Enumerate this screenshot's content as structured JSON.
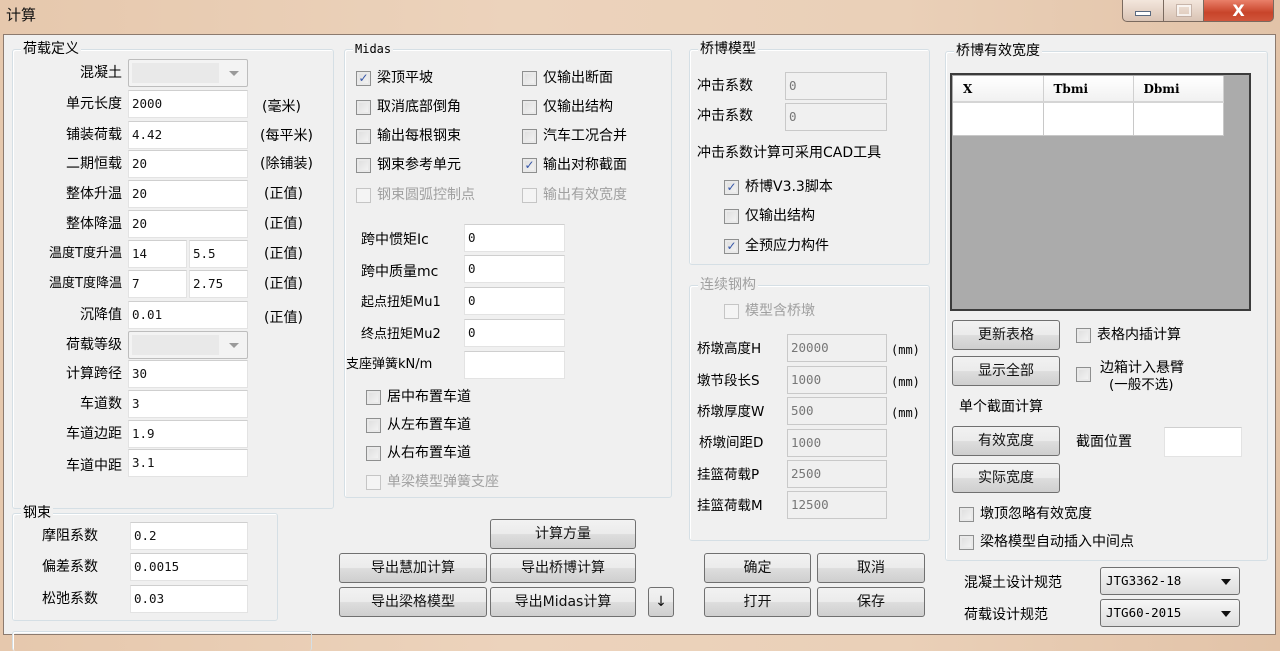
{
  "window": {
    "title": "计算",
    "controls": {
      "minimize": "minimize",
      "maximize": "maximize",
      "close": "X"
    }
  },
  "load_definition": {
    "title": "荷载定义",
    "concrete_label": "混凝土",
    "concrete_value": "",
    "element_length_label": "单元长度",
    "element_length_value": "2000",
    "element_length_unit": "(毫米)",
    "paving_load_label": "铺装荷载",
    "paving_load_value": "4.42",
    "paving_load_unit": "(每平米)",
    "second_dead_label": "二期恒载",
    "second_dead_value": "20",
    "second_dead_unit": "(除铺装)",
    "temp_rise_label": "整体升温",
    "temp_rise_value": "20",
    "temp_rise_unit": "(正值)",
    "temp_drop_label": "整体降温",
    "temp_drop_value": "20",
    "temp_drop_unit": "(正值)",
    "grad_rise_label": "温度T度升温",
    "grad_rise_value1": "14",
    "grad_rise_value2": "5.5",
    "grad_rise_unit": "(正值)",
    "grad_drop_label": "温度T度降温",
    "grad_drop_value1": "7",
    "grad_drop_value2": "2.75",
    "grad_drop_unit": "(正值)",
    "settlement_label": "沉降值",
    "settlement_value": "0.01",
    "settlement_unit": "(正值)",
    "load_grade_label": "荷载等级",
    "load_grade_value": "",
    "span_label": "计算跨径",
    "span_value": "30",
    "lanes_label": "车道数",
    "lanes_value": "3",
    "lane_edge_label": "车道边距",
    "lane_edge_value": "1.9",
    "lane_center_label": "车道中距",
    "lane_center_value": "3.1"
  },
  "tendon": {
    "title": "钢束",
    "friction_label": "摩阻系数",
    "friction_value": "0.2",
    "deviation_label": "偏差系数",
    "deviation_value": "0.0015",
    "relaxation_label": "松弛系数",
    "relaxation_value": "0.03"
  },
  "midas": {
    "title": "Midas",
    "checkboxes": [
      {
        "label": "梁顶平坡",
        "checked": true,
        "enabled": true
      },
      {
        "label": "仅输出断面",
        "checked": false,
        "enabled": true
      },
      {
        "label": "取消底部倒角",
        "checked": false,
        "enabled": true
      },
      {
        "label": "仅输出结构",
        "checked": false,
        "enabled": true
      },
      {
        "label": "输出每根钢束",
        "checked": false,
        "enabled": true
      },
      {
        "label": "汽车工况合并",
        "checked": false,
        "enabled": true
      },
      {
        "label": "钢束参考单元",
        "checked": false,
        "enabled": true
      },
      {
        "label": "输出对称截面",
        "checked": true,
        "enabled": true
      },
      {
        "label": "钢束圆弧控制点",
        "checked": false,
        "enabled": false
      },
      {
        "label": "输出有效宽度",
        "checked": false,
        "enabled": false
      }
    ],
    "inertia_label": "跨中惯矩Ic",
    "inertia_value": "0",
    "mass_label": "跨中质量mc",
    "mass_value": "0",
    "torsion_start_label": "起点扭矩Mu1",
    "torsion_start_value": "0",
    "torsion_end_label": "终点扭矩Mu2",
    "torsion_end_value": "0",
    "spring_label": "支座弹簧kN/m",
    "spring_value": "",
    "lane_checkboxes": [
      {
        "label": "居中布置车道",
        "checked": false,
        "enabled": true
      },
      {
        "label": "从左布置车道",
        "checked": false,
        "enabled": true
      },
      {
        "label": "从右布置车道",
        "checked": false,
        "enabled": true
      },
      {
        "label": "单梁模型弹簧支座",
        "checked": false,
        "enabled": false
      }
    ]
  },
  "qiaobo": {
    "title": "桥博模型",
    "impact1_label": "冲击系数",
    "impact1_value": "0",
    "impact2_label": "冲击系数",
    "impact2_value": "0",
    "impact_note": "冲击系数计算可采用CAD工具",
    "checkboxes": [
      {
        "label": "桥博V3.3脚本",
        "checked": true,
        "enabled": true
      },
      {
        "label": "仅输出结构",
        "checked": false,
        "enabled": true
      },
      {
        "label": "全预应力构件",
        "checked": true,
        "enabled": true
      }
    ]
  },
  "continuous": {
    "title": "连续钢构",
    "include_pier_label": "模型含桥墩",
    "include_pier_checked": false,
    "pier_height_label": "桥墩高度H",
    "pier_height_value": "20000",
    "pier_height_unit": "(mm)",
    "segment_label": "墩节段长S",
    "segment_value": "1000",
    "segment_unit": "(mm)",
    "thickness_label": "桥墩厚度W",
    "thickness_value": "500",
    "thickness_unit": "(mm)",
    "spacing_label": "桥墩间距D",
    "spacing_value": "1000",
    "hanging_p_label": "挂篮荷载P",
    "hanging_p_value": "2500",
    "hanging_m_label": "挂篮荷载M",
    "hanging_m_value": "12500"
  },
  "effective_width": {
    "title": "桥博有效宽度",
    "columns": [
      "X",
      "Tbmi",
      "Dbmi"
    ],
    "rows": [
      [
        "",
        "",
        ""
      ]
    ],
    "update_table_button": "更新表格",
    "table_interp_label": "表格内插计算",
    "table_interp_checked": false,
    "show_all_button": "显示全部",
    "side_box_label": "边箱计入悬臂",
    "side_box_note": "(一般不选)",
    "side_box_checked": false,
    "single_section_label": "单个截面计算",
    "effective_width_button": "有效宽度",
    "section_pos_label": "截面位置",
    "section_pos_value": "",
    "actual_width_button": "实际宽度",
    "pier_top_ignore_label": "墩顶忽略有效宽度",
    "pier_top_ignore_checked": false,
    "grid_insert_label": "梁格模型自动插入中间点",
    "grid_insert_checked": false
  },
  "codes": {
    "concrete_code_label": "混凝土设计规范",
    "concrete_code_value": "JTG3362-18",
    "load_code_label": "荷载设计规范",
    "load_code_value": "JTG60-2015"
  },
  "buttons": {
    "calc_quantity": "计算方量",
    "export_huijia": "导出慧加计算",
    "export_qiaobo": "导出桥博计算",
    "export_grid": "导出梁格模型",
    "export_midas": "导出Midas计算",
    "down_arrow": "↓",
    "ok": "确定",
    "cancel": "取消",
    "open": "打开",
    "save": "保存"
  }
}
